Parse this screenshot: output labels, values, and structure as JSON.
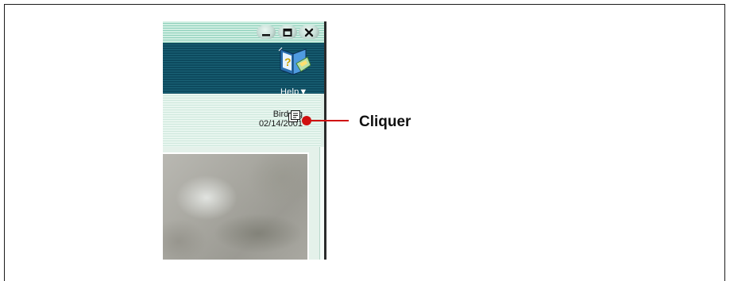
{
  "window": {
    "buttons": {
      "minimize_icon": "minimize-icon",
      "maximize_icon": "maximize-icon",
      "close_icon": "close-icon"
    }
  },
  "header": {
    "help_label": "Help▼",
    "help_icon": "help-book-icon"
  },
  "file_info": {
    "name": "Bird.jpg",
    "date": "02/14/2001",
    "icon": "file-properties-icon"
  },
  "annotation": {
    "label": "Cliquer",
    "color": "#d01010"
  },
  "colors": {
    "header_dark": "#0d4a5e",
    "panel_light": "#e8f6ef",
    "titlebar": "#8ed0bb"
  }
}
